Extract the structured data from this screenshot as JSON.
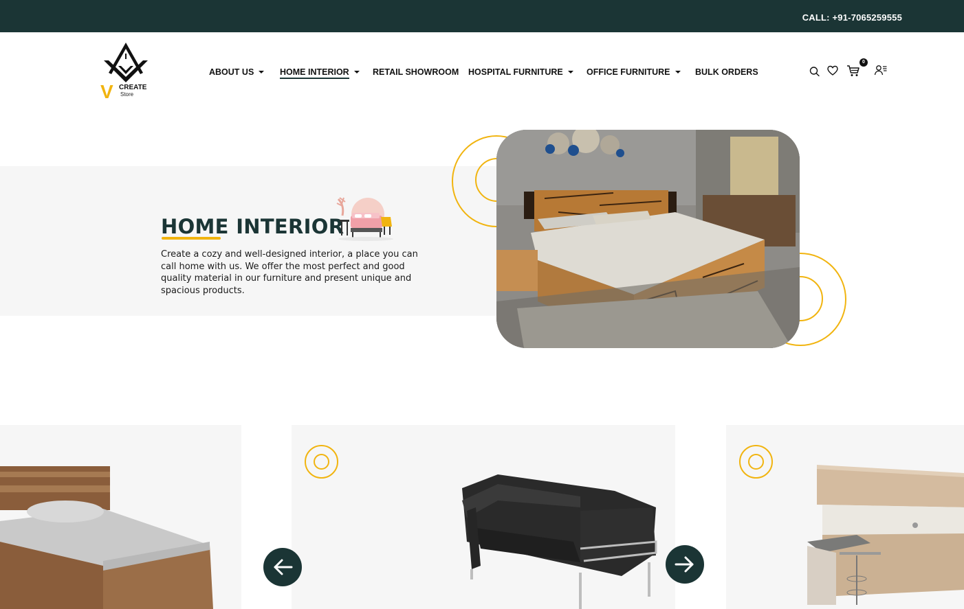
{
  "topbar": {
    "call_text": "CALL: +91-7065259555"
  },
  "logo": {
    "letter": "V",
    "line1": "CREATE",
    "line2": "Store"
  },
  "nav": {
    "items": [
      {
        "label": "ABOUT US",
        "dropdown": true
      },
      {
        "label": "HOME INTERIOR",
        "dropdown": true,
        "active": true
      },
      {
        "label": "RETAIL SHOWROOM",
        "dropdown": false
      },
      {
        "label": "HOSPITAL FURNITURE",
        "dropdown": true
      },
      {
        "label": "OFFICE FURNITURE",
        "dropdown": true
      },
      {
        "label": "BULK ORDERS",
        "dropdown": false
      }
    ]
  },
  "header_icons": {
    "search": "search-icon",
    "wishlist": "heart-icon",
    "cart": "cart-icon",
    "cart_count": "0",
    "account": "user-menu-icon"
  },
  "hero": {
    "title": "HOME INTERIOR",
    "description": "Create a cozy and well-designed interior, a place you can call home with us. We offer the most perfect and good quality material in our furniture and present unique and spacious products."
  },
  "carousel": {
    "prev_icon": "arrow-left-icon",
    "next_icon": "arrow-right-icon",
    "items": [
      "single-bed",
      "leather-sofa",
      "modular-kitchen"
    ]
  },
  "colors": {
    "brand_dark": "#1b3535",
    "accent_yellow": "#f1b40f",
    "band_gray": "#f6f6f6"
  }
}
